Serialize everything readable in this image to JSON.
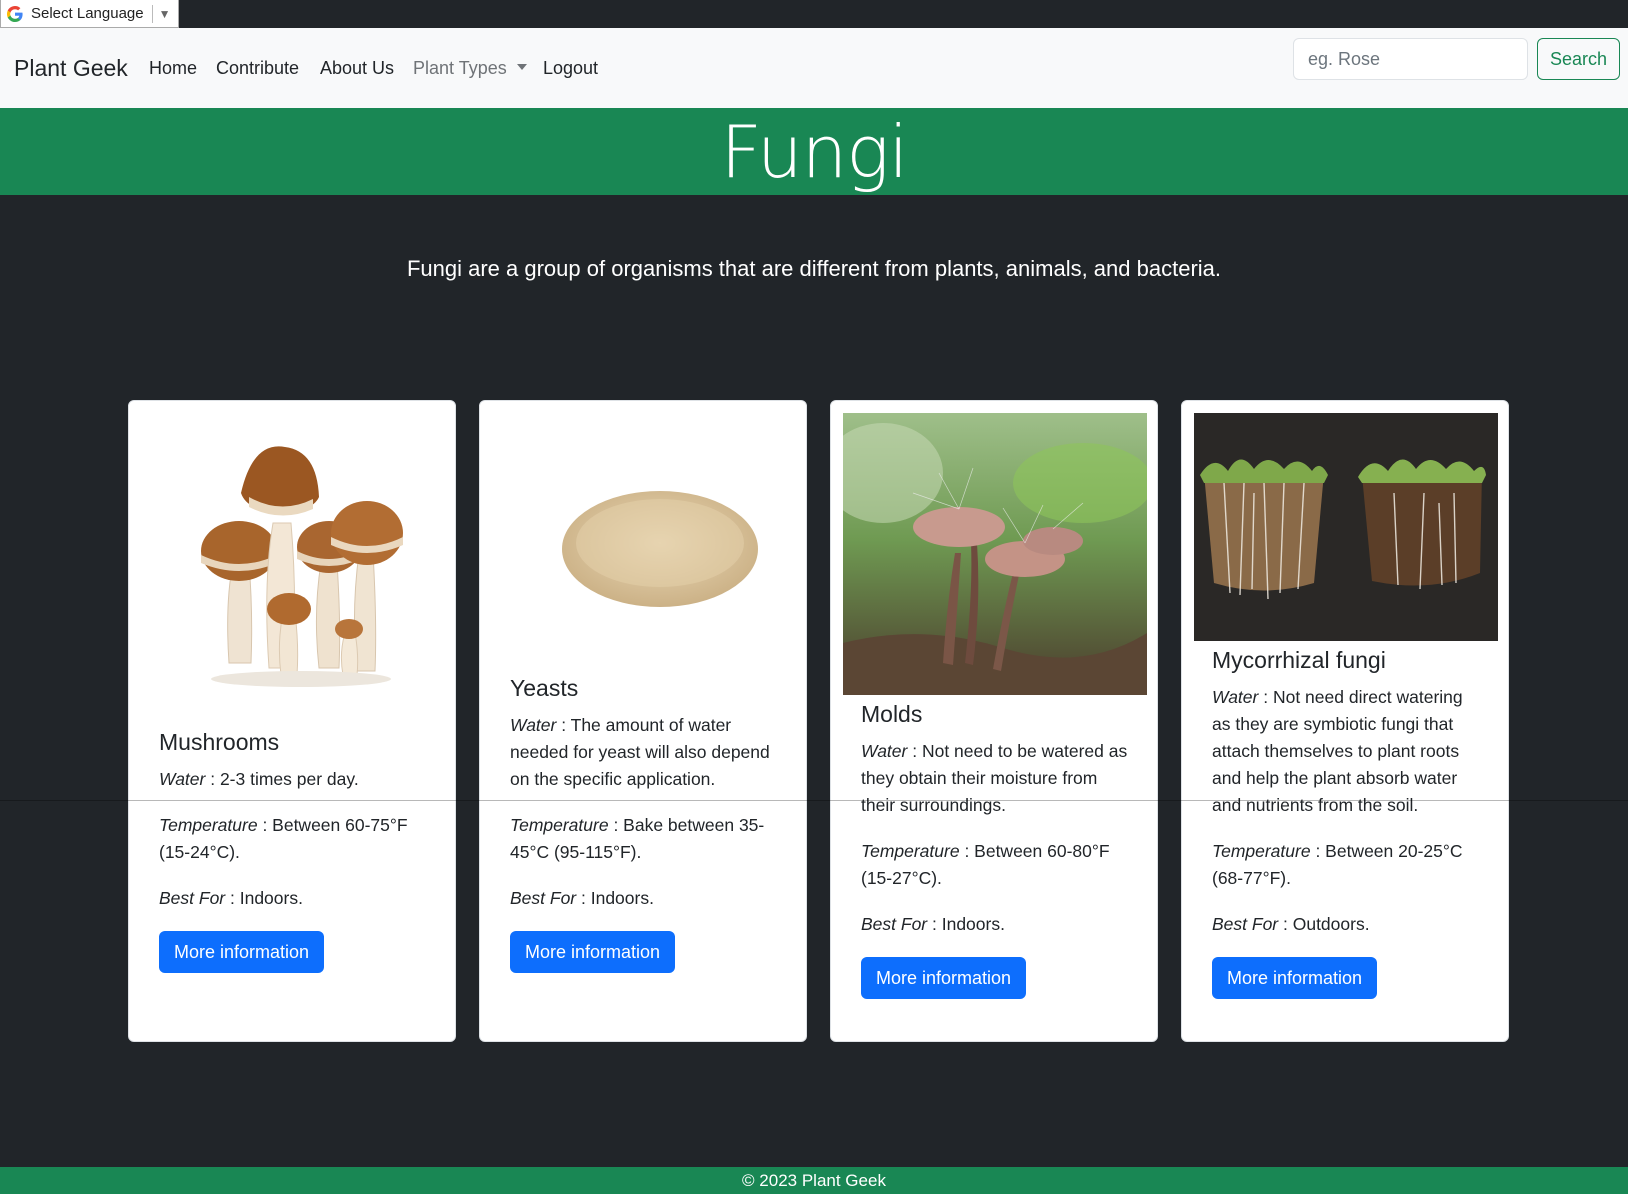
{
  "translate": {
    "label": "Select Language",
    "arrow": "▼"
  },
  "navbar": {
    "brand": "Plant Geek",
    "links": [
      "Home",
      "Contribute",
      "About Us",
      "Plant Types",
      "Logout"
    ],
    "search_placeholder": "eg. Rose",
    "search_button": "Search"
  },
  "hero": {
    "title": "Fungi"
  },
  "intro": "Fungi are a group of organisms that are different from plants, animals, and bacteria.",
  "cards": [
    {
      "title": "Mushrooms",
      "water_label": "Water",
      "water": " : 2-3 times per day.",
      "temp_label": "Temperature",
      "temp": " : Between 60-75°F (15-24°C).",
      "best_label": "Best For",
      "best": " : Indoors.",
      "button": "More information"
    },
    {
      "title": "Yeasts",
      "water_label": "Water",
      "water": " : The amount of water needed for yeast will also depend on the specific application.",
      "temp_label": "Temperature",
      "temp": " : Bake between 35-45°C (95-115°F).",
      "best_label": "Best For",
      "best": " : Indoors.",
      "button": "More information"
    },
    {
      "title": "Molds",
      "water_label": "Water",
      "water": " : Not need to be watered as they obtain their moisture from their surroundings.",
      "temp_label": "Temperature",
      "temp": " : Between 60-80°F (15-27°C).",
      "best_label": "Best For",
      "best": " : Indoors.",
      "button": "More information"
    },
    {
      "title": "Mycorrhizal fungi",
      "water_label": "Water",
      "water": " : Not need direct watering as they are symbiotic fungi that attach themselves to plant roots and help the plant absorb water and nutrients from the soil.",
      "temp_label": "Temperature",
      "temp": " : Between 20-25°C (68-77°F).",
      "best_label": "Best For",
      "best": " : Outdoors.",
      "button": "More information"
    }
  ],
  "footer": "© 2023 Plant Geek",
  "colors": {
    "green": "#198754",
    "dark": "#212529",
    "primary": "#0d6efd"
  }
}
